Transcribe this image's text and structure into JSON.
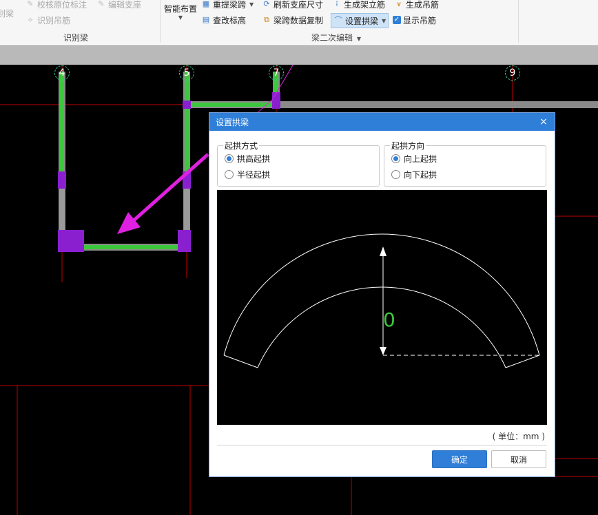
{
  "ribbon": {
    "left_items": [
      {
        "label": "校核原位标注",
        "icon": "check-annotation-icon"
      },
      {
        "label": "编辑支座",
        "icon": "edit-support-icon"
      },
      {
        "label": "识别吊筋",
        "icon": "identify-hanger-icon"
      }
    ],
    "left_partial_label": "识别梁",
    "group1_label": "识别梁",
    "smart_layout_label": "智能布置",
    "items": {
      "re_extract_span": "重提梁跨",
      "refresh_support_size": "刷新支座尺寸",
      "generate_stirrup": "生成架立筋",
      "generate_hanger": "生成吊筋",
      "modify_elevation": "查改标高",
      "span_data_copy": "梁跨数据复制",
      "set_arch_beam": "设置拱梁",
      "show_hanger": "显示吊筋"
    },
    "group2_label": "梁二次编辑"
  },
  "axes": [
    "4",
    "5",
    "7",
    "9"
  ],
  "dialog": {
    "title": "设置拱梁",
    "close_glyph": "×",
    "arch_mode": {
      "legend": "起拱方式",
      "options": [
        "拱高起拱",
        "半径起拱"
      ],
      "selected": "拱高起拱"
    },
    "arch_direction": {
      "legend": "起拱方向",
      "options": [
        "向上起拱",
        "向下起拱"
      ],
      "selected": "向上起拱"
    },
    "preview": {
      "arch_height_value": "0"
    },
    "unit_text": "( 单位：mm )",
    "ok_label": "确定",
    "cancel_label": "取消"
  },
  "colors": {
    "accent": "#2f7fd9",
    "beam_green": "#3cc83c",
    "support_purple": "#8a1fd0",
    "axis_red": "#d00000",
    "arrow_magenta": "#e020e0"
  }
}
